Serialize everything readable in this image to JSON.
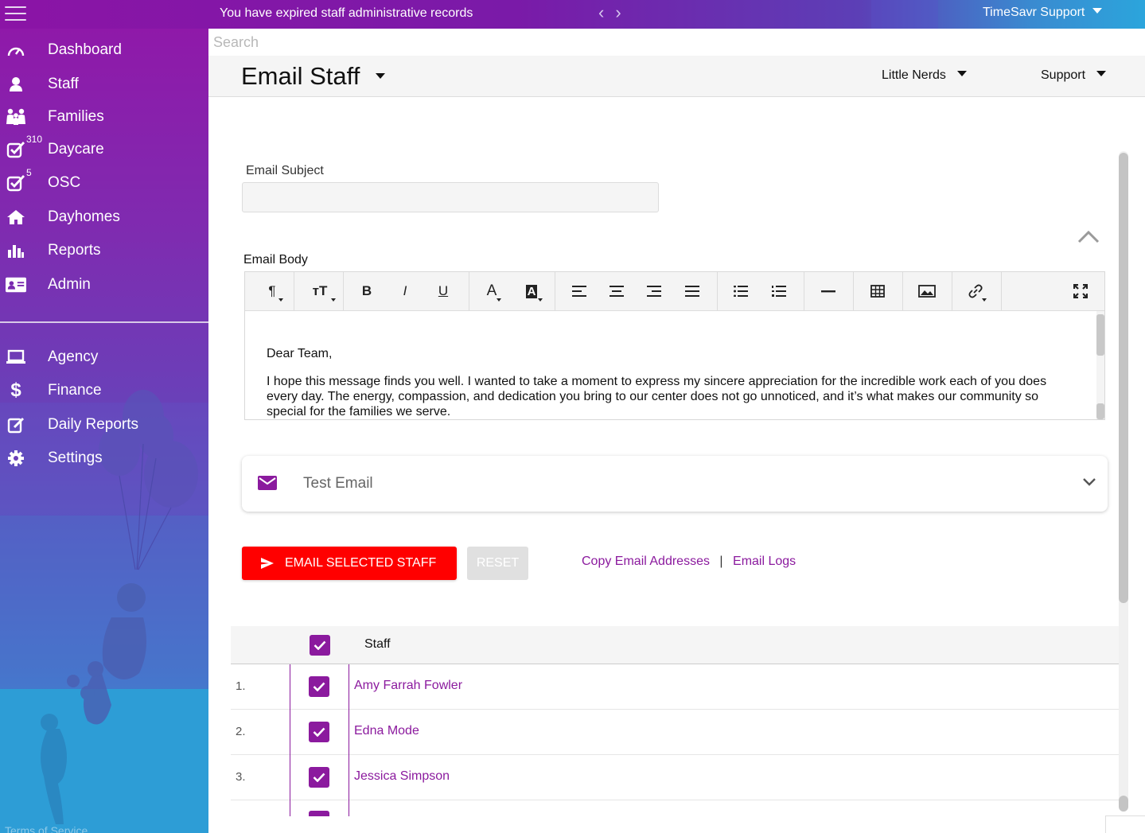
{
  "topbar": {
    "alert": "You have expired staff administrative records",
    "user_label": "TimeSavr Support"
  },
  "sidebar": {
    "items": [
      {
        "label": "Dashboard",
        "icon": "speedometer-icon"
      },
      {
        "label": "Staff",
        "icon": "person-icon"
      },
      {
        "label": "Families",
        "icon": "family-icon"
      },
      {
        "label": "Daycare",
        "icon": "checkbox-icon",
        "badge": "310"
      },
      {
        "label": "OSC",
        "icon": "checkbox-icon",
        "badge": "5"
      },
      {
        "label": "Dayhomes",
        "icon": "home-icon"
      },
      {
        "label": "Reports",
        "icon": "bar-chart-icon"
      },
      {
        "label": "Admin",
        "icon": "id-card-icon"
      }
    ],
    "items2": [
      {
        "label": "Agency",
        "icon": "laptop-icon"
      },
      {
        "label": "Finance",
        "icon": "dollar-icon"
      },
      {
        "label": "Daily Reports",
        "icon": "edit-icon"
      },
      {
        "label": "Settings",
        "icon": "gear-icon"
      }
    ],
    "terms": "Terms of Service"
  },
  "search": {
    "placeholder": "Search"
  },
  "header": {
    "title": "Email Staff",
    "org_dropdown": "Little Nerds",
    "support_dropdown": "Support"
  },
  "form": {
    "subject_label": "Email Subject",
    "subject_value": "",
    "body_label": "Email Body",
    "body_paragraphs": [
      "Dear Team,",
      "I hope this message finds you well. I wanted to take a moment to express my sincere appreciation for the incredible work each of you does every day. The energy, compassion, and dedication you bring to our center does not go unnoticed, and it’s what makes our community so special for the families we serve."
    ],
    "test_email_label": "Test Email",
    "send_button": "EMAIL SELECTED STAFF",
    "reset_button": "RESET",
    "copy_link": "Copy Email Addresses",
    "link_separator": "|",
    "logs_link": "Email Logs"
  },
  "table": {
    "header": "Staff",
    "rows": [
      {
        "num": "1.",
        "name": "Amy Farrah Fowler",
        "checked": true
      },
      {
        "num": "2.",
        "name": "Edna Mode",
        "checked": true
      },
      {
        "num": "3.",
        "name": "Jessica Simpson",
        "checked": true
      }
    ]
  },
  "colors": {
    "brand_purple": "#8b1a9e",
    "send_red": "#ff0000",
    "gradient_blue": "#2ba5dc"
  }
}
